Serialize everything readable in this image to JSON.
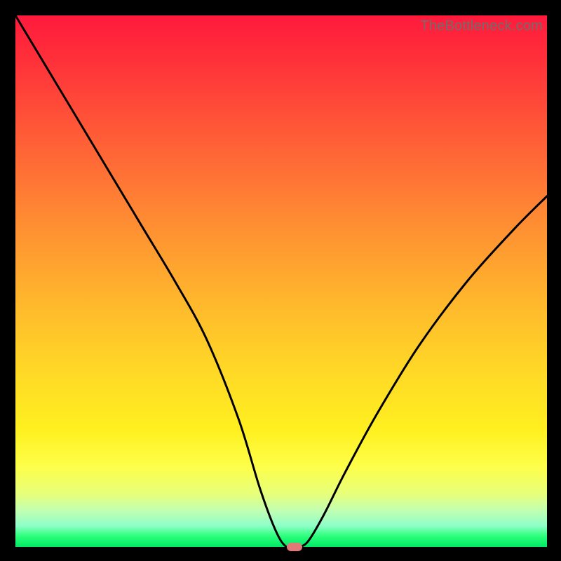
{
  "watermark": "TheBottleneck.com",
  "colors": {
    "gradient_top": "#ff1a3c",
    "gradient_mid": "#ffd427",
    "gradient_bottom": "#00e865",
    "curve": "#000000",
    "marker": "#df7a78",
    "frame": "#000000"
  },
  "chart_data": {
    "type": "line",
    "title": "",
    "xlabel": "",
    "ylabel": "",
    "xlim": [
      0,
      100
    ],
    "ylim": [
      0,
      100
    ],
    "grid": false,
    "legend": false,
    "series": [
      {
        "name": "bottleneck-curve",
        "x": [
          0,
          6,
          12,
          18,
          24,
          30,
          36,
          42,
          46,
          49,
          51,
          53,
          55,
          58,
          62,
          68,
          76,
          85,
          94,
          100
        ],
        "y": [
          100,
          90,
          80,
          70,
          60,
          50,
          39,
          24,
          11,
          3,
          0,
          0,
          1,
          6,
          14,
          25,
          38,
          50,
          60,
          66
        ]
      }
    ],
    "marker": {
      "x": 52.5,
      "y": 0
    },
    "gradient_stops": [
      {
        "pos": 0,
        "color": "#ff1a3c"
      },
      {
        "pos": 22,
        "color": "#ff5a37"
      },
      {
        "pos": 52,
        "color": "#ffb22d"
      },
      {
        "pos": 78,
        "color": "#fff020"
      },
      {
        "pos": 96,
        "color": "#8effc8"
      },
      {
        "pos": 100,
        "color": "#00e865"
      }
    ]
  }
}
